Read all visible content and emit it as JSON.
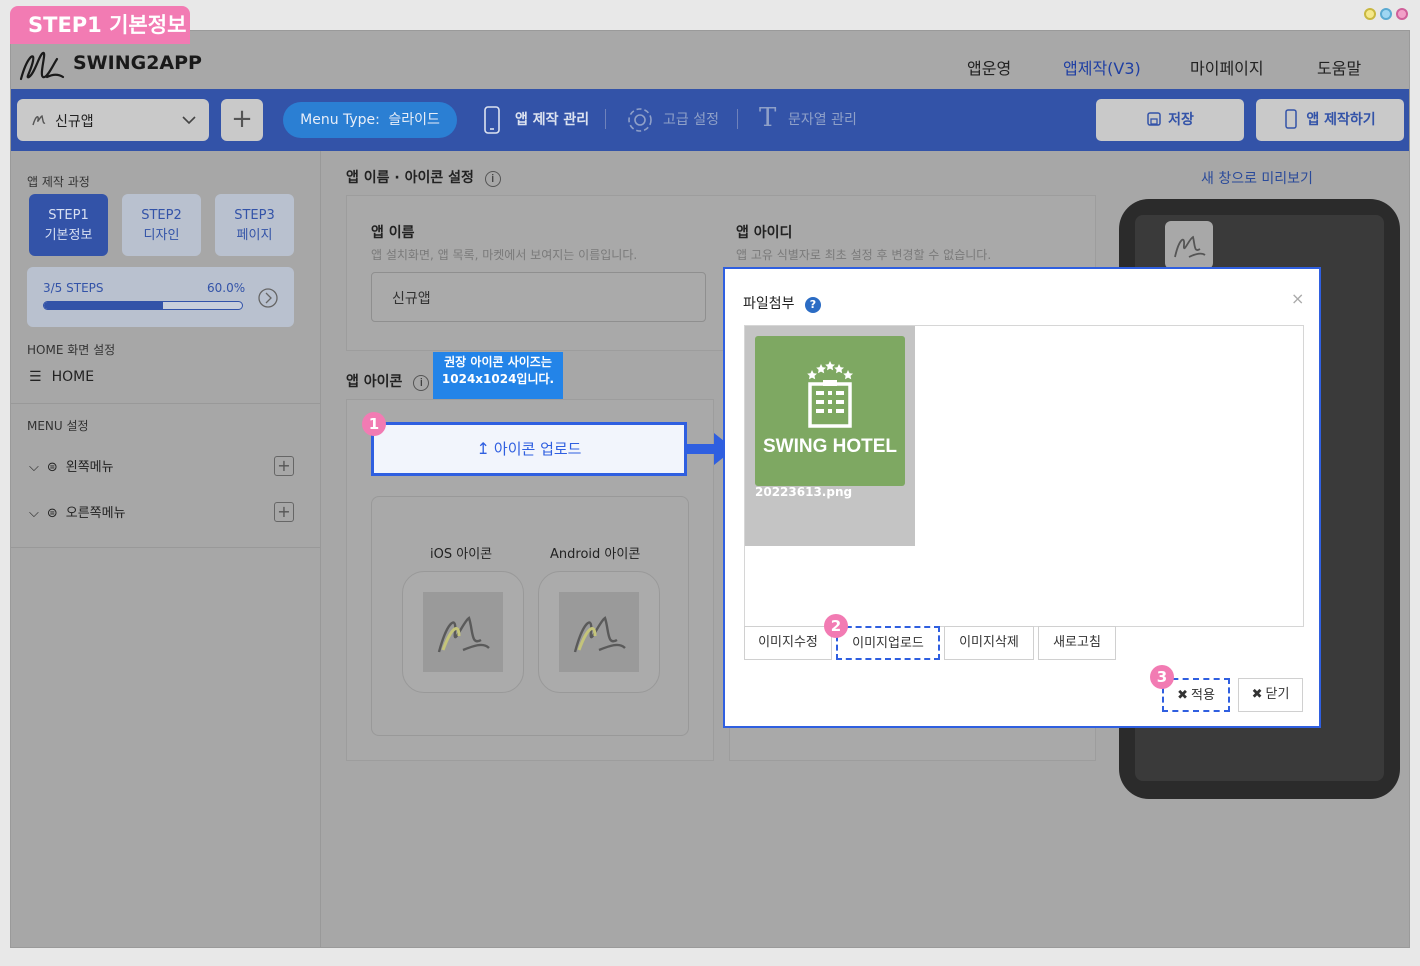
{
  "badge": "STEP1 기본정보",
  "brand": "SWING2APP",
  "nav": [
    "앱운영",
    "앱제작(V3)",
    "마이페이지",
    "도움말"
  ],
  "toolbar": {
    "app_select": "신규앱",
    "menu_type_label": "Menu Type:",
    "menu_type_value": "슬라이드",
    "app_manage": "앱 제작 관리",
    "advanced": "고급 설정",
    "strings": "문자열 관리",
    "save": "저장",
    "build": "앱 제작하기"
  },
  "sidebar": {
    "process_label": "앱 제작 과정",
    "steps": [
      {
        "line1": "STEP1",
        "line2": "기본정보"
      },
      {
        "line1": "STEP2",
        "line2": "디자인"
      },
      {
        "line1": "STEP3",
        "line2": "페이지"
      }
    ],
    "progress_text": "3/5 STEPS",
    "progress_percent": "60.0%",
    "progress_value": 0.6,
    "home_section": "HOME 화면 설정",
    "home_item": "HOME",
    "menu_section": "MENU 설정",
    "menus": [
      "왼쪽메뉴",
      "오른쪽메뉴"
    ]
  },
  "main": {
    "name_icon_title": "앱 이름 · 아이콘 설정",
    "app_name_label": "앱 이름",
    "app_name_desc": "앱 설치화면, 앱 목록, 마켓에서 보여지는 이름입니다.",
    "app_name_value": "신규앱",
    "app_id_label": "앱 아이디",
    "app_id_desc": "앱 고유 식별자로 최초 설정 후 변경할 수 없습니다.",
    "icon_title": "앱 아이콘",
    "tooltip": "권장 아이콘 사이즈는 1024x1024입니다.",
    "upload_btn": "아이콘 업로드",
    "ios_icon": "iOS 아이콘",
    "android_icon": "Android 아이콘"
  },
  "preview_link": "새 창으로 미리보기",
  "dialog": {
    "title": "파일첨부",
    "file_name": "20223613.png",
    "thumb_text": "SWING HOTEL",
    "buttons": [
      "이미지수정",
      "이미지업로드",
      "이미지삭제",
      "새로고침"
    ],
    "apply": "적용",
    "close": "닫기"
  },
  "markers": [
    "1",
    "2",
    "3"
  ],
  "colors": {
    "accent": "#3353a8",
    "badge": "#f27bb3",
    "highlight": "#2f5fe0",
    "hotel_green": "#7ea862"
  }
}
